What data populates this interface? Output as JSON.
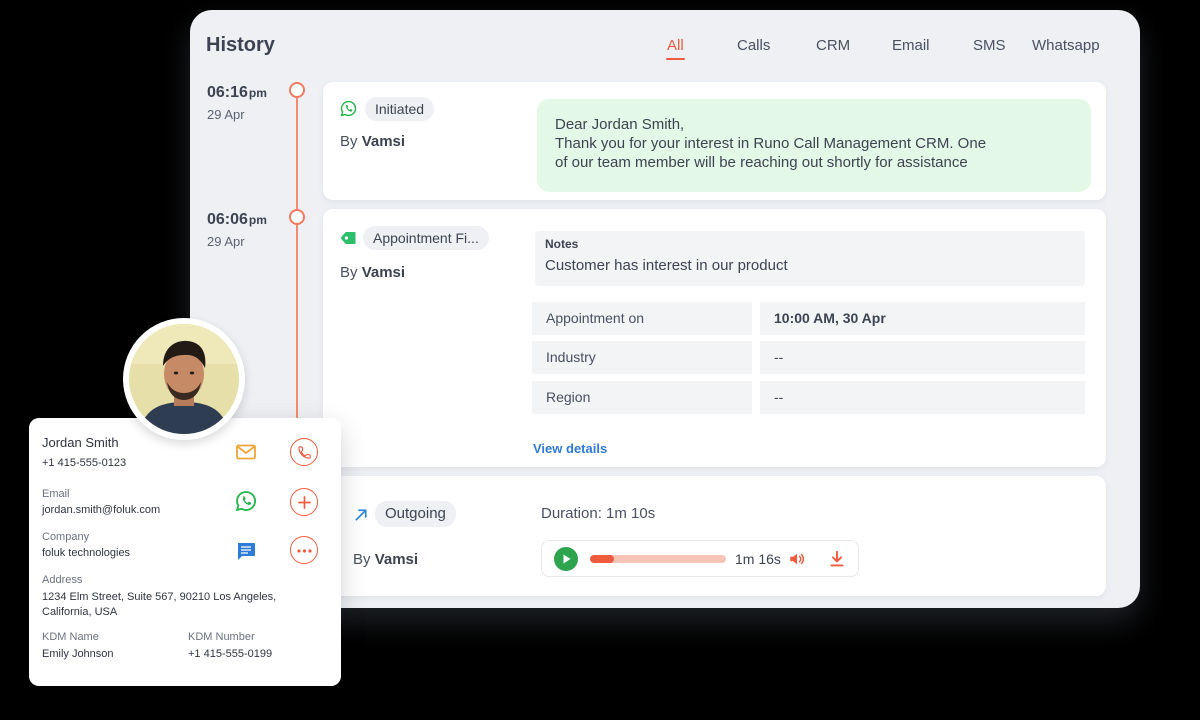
{
  "history": {
    "title": "History",
    "tabs": [
      {
        "label": "All",
        "active": true
      },
      {
        "label": "Calls",
        "active": false
      },
      {
        "label": "CRM",
        "active": false
      },
      {
        "label": "Email",
        "active": false
      },
      {
        "label": "SMS",
        "active": false
      },
      {
        "label": "Whatsapp",
        "active": false
      }
    ]
  },
  "timeline": [
    {
      "time": "06:16",
      "ampm": "pm",
      "date": "29 Apr",
      "chip": "Initiated",
      "chip_icon": "whatsapp-icon",
      "by_prefix": "By",
      "by_name": "Vamsi",
      "message": [
        "Dear Jordan Smith,",
        "Thank you for your interest in Runo Call Management CRM. One",
        "of our team member will be reaching out shortly for assistance"
      ]
    },
    {
      "time": "06:06",
      "ampm": "pm",
      "date": "29 Apr",
      "chip": "Appointment Fi...",
      "chip_icon": "tag-icon",
      "by_prefix": "By",
      "by_name": "Vamsi",
      "notes_title": "Notes",
      "notes_text": "Customer has interest in our product",
      "fields": [
        {
          "label": "Appointment on",
          "value": "10:00 AM, 30 Apr"
        },
        {
          "label": "Industry",
          "value": "--"
        },
        {
          "label": "Region",
          "value": "--"
        }
      ],
      "view_details": "View details"
    },
    {
      "chip": "Outgoing",
      "chip_icon": "outgoing-arrow-icon",
      "by_prefix": "By",
      "by_name": "Vamsi",
      "duration": "Duration: 1m 10s",
      "player": {
        "time": "1m 16s",
        "progress": 0.18
      }
    }
  ],
  "contact": {
    "name": "Jordan Smith",
    "phone": "+1 415-555-0123",
    "email_label": "Email",
    "email": "jordan.smith@foluk.com",
    "company_label": "Company",
    "company": "foluk technologies",
    "address_label": "Address",
    "address": [
      "1234 Elm Street, Suite 567, 90210 Los Angeles,",
      "California, USA"
    ],
    "kdm_name_label": "KDM Name",
    "kdm_name": "Emily Johnson",
    "kdm_number_label": "KDM Number",
    "kdm_number": "+1 415-555-0199"
  },
  "colors": {
    "accent": "#ef5b3f",
    "whatsapp": "#25b54b",
    "link": "#2f7bd8",
    "bubble": "#e4f8e8"
  }
}
